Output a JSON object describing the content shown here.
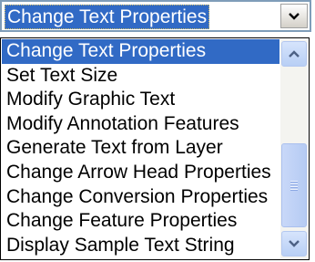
{
  "combo": {
    "selected_value": "Change Text Properties",
    "button_icon": "chevron-down-icon"
  },
  "dropdown": {
    "options": [
      "Change Text Properties",
      "Set Text Size",
      "Modify Graphic Text",
      "Modify Annotation Features",
      "Generate Text from Layer",
      "Change Arrow Head Properties",
      "Change Conversion Properties",
      "Change Feature Properties",
      "Display Sample Text String"
    ],
    "selected_index": 0
  },
  "scrollbar": {
    "up_icon": "chevron-up-icon",
    "down_icon": "chevron-down-icon",
    "thumb_icon": "grip-icon"
  },
  "colors": {
    "selection": "#316ac5",
    "scroll_arrow": "#4d6185"
  }
}
